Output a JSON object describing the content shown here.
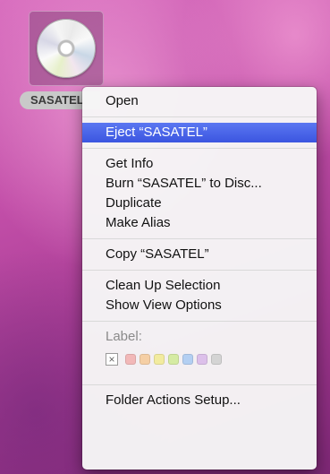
{
  "desktop": {
    "volume_label": "SASATEL"
  },
  "context_menu": {
    "groups": [
      [
        "Open"
      ],
      [
        "Eject “SASATEL”"
      ],
      [
        "Get Info",
        "Burn “SASATEL” to Disc...",
        "Duplicate",
        "Make Alias"
      ],
      [
        "Copy “SASATEL”"
      ],
      [
        "Clean Up Selection",
        "Show View Options"
      ]
    ],
    "selected_item": "Eject “SASATEL”",
    "label_title": "Label:",
    "label_none_glyph": "×",
    "label_colors": [
      "#f2b8b8",
      "#f5cfa5",
      "#f2eb9f",
      "#d5eba3",
      "#b3cff2",
      "#dcc0ea",
      "#d4d4d4"
    ],
    "last_item": "Folder Actions Setup..."
  },
  "colors": {
    "selection": "#3b55e0"
  }
}
